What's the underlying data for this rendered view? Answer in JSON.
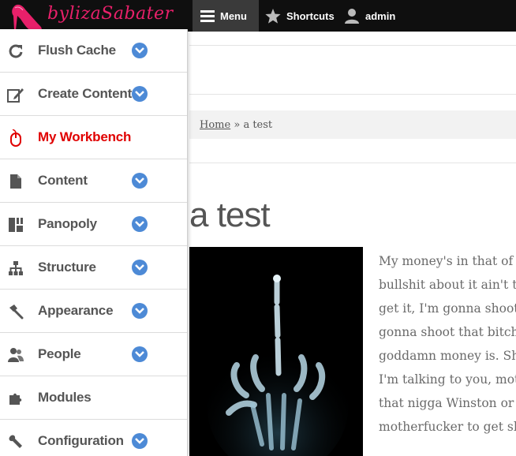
{
  "toolbar": {
    "logo_text": "bylizaSabater",
    "menu_label": "Menu",
    "shortcuts_label": "Shortcuts",
    "user_label": "admin"
  },
  "breadcrumb": {
    "home": "Home",
    "separator": "»",
    "current": "a test"
  },
  "page": {
    "title": "a test",
    "body_lines": [
      "My money's in that of",
      "bullshit about it ain't th",
      "get it, I'm gonna shoot",
      "gonna shoot that bitch",
      "goddamn money is. Sh",
      "I'm talking to you, mot",
      "that nigga Winston or",
      "motherfucker to get sh"
    ]
  },
  "tray": {
    "items": [
      {
        "label": "Flush Cache",
        "icon": "refresh-icon",
        "expandable": true,
        "active": false
      },
      {
        "label": "Create Content",
        "icon": "edit-icon",
        "expandable": true,
        "active": false
      },
      {
        "label": "My Workbench",
        "icon": "mouse-icon",
        "expandable": false,
        "active": true
      },
      {
        "label": "Content",
        "icon": "document-icon",
        "expandable": true,
        "active": false
      },
      {
        "label": "Panopoly",
        "icon": "layout-icon",
        "expandable": true,
        "active": false
      },
      {
        "label": "Structure",
        "icon": "sitemap-icon",
        "expandable": true,
        "active": false
      },
      {
        "label": "Appearance",
        "icon": "brush-icon",
        "expandable": true,
        "active": false
      },
      {
        "label": "People",
        "icon": "people-icon",
        "expandable": true,
        "active": false
      },
      {
        "label": "Modules",
        "icon": "puzzle-icon",
        "expandable": false,
        "active": false
      },
      {
        "label": "Configuration",
        "icon": "wrench-icon",
        "expandable": true,
        "active": false
      }
    ]
  },
  "colors": {
    "toolbar_bg": "#0f0f0f",
    "active_item": "#e00000",
    "chevron_blue": "#4d8ad6",
    "logo_pink": "#e8206a"
  }
}
